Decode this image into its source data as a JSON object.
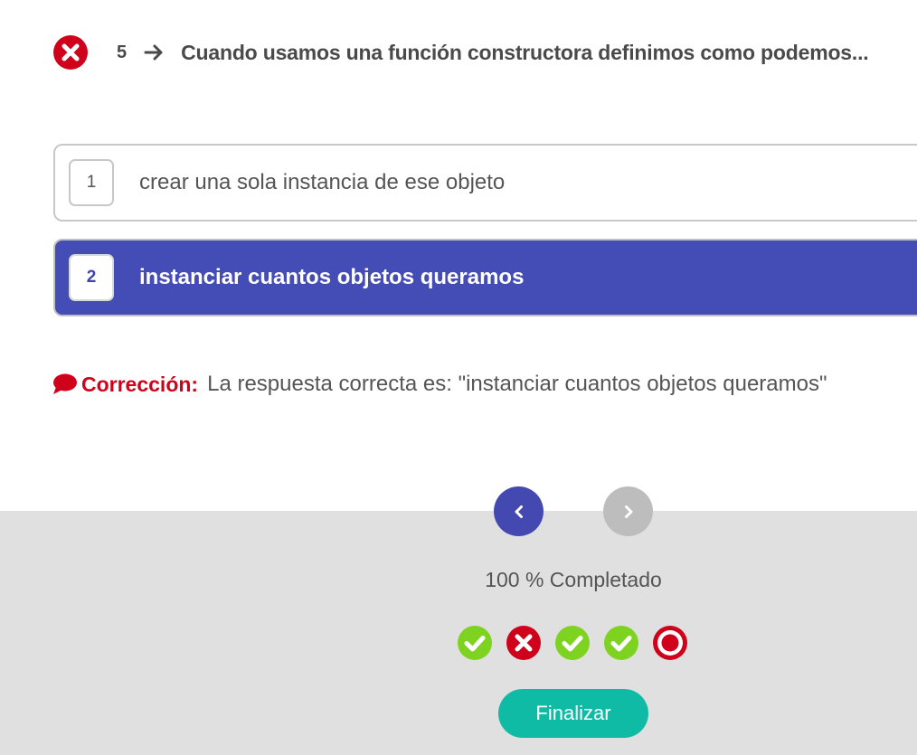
{
  "question": {
    "status": "incorrect",
    "status_icon": "x-circle-icon",
    "number": "5",
    "arrow_icon": "arrow-right-icon",
    "title": "Cuando usamos una función constructora definimos como podemos..."
  },
  "options": [
    {
      "key": "1",
      "text": "crear una sola instancia de ese objeto",
      "selected": false
    },
    {
      "key": "2",
      "text": "instanciar cuantos objetos queramos",
      "selected": true
    }
  ],
  "correction": {
    "icon": "comment-icon",
    "label": "Corrección:",
    "text": "La respuesta correcta es: \"instanciar cuantos objetos queramos\""
  },
  "navigation": {
    "prev_icon": "chevron-left-icon",
    "next_icon": "chevron-right-icon",
    "next_enabled": false
  },
  "progress": {
    "text": "100 % Completado",
    "value": 100,
    "results": [
      "correct",
      "incorrect",
      "correct",
      "correct",
      "current"
    ]
  },
  "finish_label": "Finalizar",
  "colors": {
    "accent": "#444cb5",
    "correct": "#7ed321",
    "incorrect": "#d0021b",
    "finish": "#10bba6",
    "footer_bg": "#e0e0e0"
  }
}
